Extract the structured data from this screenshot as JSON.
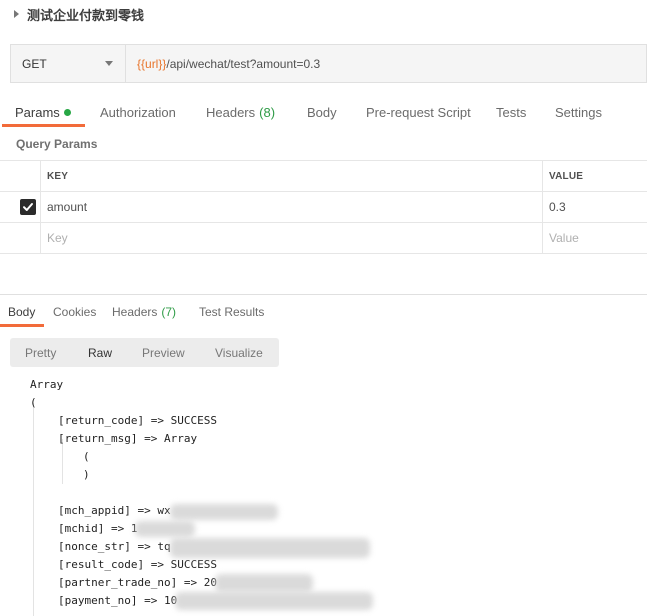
{
  "request": {
    "title": "测试企业付款到零钱"
  },
  "urlbar": {
    "method": "GET",
    "url_variable": "{{url}}",
    "url_path": "/api/wechat/test?amount=0.3"
  },
  "request_tabs": [
    {
      "label": "Params",
      "count": ""
    },
    {
      "label": "Authorization",
      "count": ""
    },
    {
      "label": "Headers",
      "count": "(8)"
    },
    {
      "label": "Body",
      "count": ""
    },
    {
      "label": "Pre-request Script",
      "count": ""
    },
    {
      "label": "Tests",
      "count": ""
    },
    {
      "label": "Settings",
      "count": ""
    }
  ],
  "query_params": {
    "label": "Query Params",
    "headers": {
      "key": "KEY",
      "value": "VALUE"
    },
    "rows": [
      {
        "checked": true,
        "key": "amount",
        "value": "0.3"
      }
    ],
    "placeholder": {
      "key": "Key",
      "value": "Value"
    }
  },
  "response_tabs": [
    {
      "label": "Body",
      "count": ""
    },
    {
      "label": "Cookies",
      "count": ""
    },
    {
      "label": "Headers",
      "count": "(7)"
    },
    {
      "label": "Test Results",
      "count": ""
    }
  ],
  "view_modes": [
    "Pretty",
    "Raw",
    "Preview",
    "Visualize"
  ],
  "response_body": {
    "lines": [
      "Array",
      "(",
      "[return_code] => SUCCESS",
      "[return_msg] => Array",
      "(",
      ")",
      "",
      "[mch_appid] => wx",
      "[mchid] => 1",
      "[nonce_str] => tq",
      "[result_code] => SUCCESS",
      "[partner_trade_no] => 20",
      "[payment_no] => 10"
    ]
  },
  "colors": {
    "accent_orange": "#f26b3a",
    "status_green": "#27a745",
    "variable_orange": "#e8742a"
  }
}
